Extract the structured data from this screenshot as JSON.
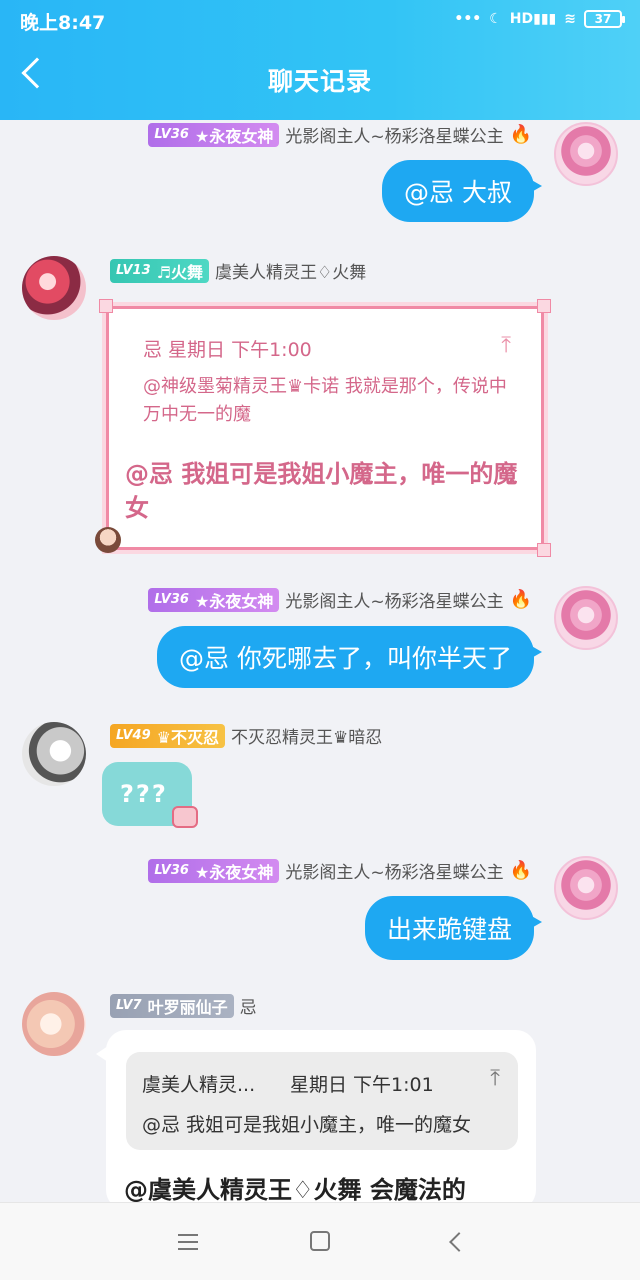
{
  "status_bar": {
    "time": "晚上8:47",
    "signal_text": "HD",
    "battery": "37"
  },
  "header": {
    "title": "聊天记录"
  },
  "messages": [
    {
      "badge_level": "LV36",
      "badge_title": "★永夜女神",
      "name": "光影阁主人~杨彩洛星蝶公主",
      "text": "@忌 大叔"
    },
    {
      "badge_level": "LV13",
      "badge_title": "♬火舞",
      "name": "虞美人精灵王♢火舞",
      "quote_header": "忌  星期日 下午1:00",
      "quote_text": "@神级墨菊精灵王♛卡诺 我就是那个，传说中万中无一的魔",
      "text": "@忌 我姐可是我姐小魔主，唯一的魔女"
    },
    {
      "badge_level": "LV36",
      "badge_title": "★永夜女神",
      "name": "光影阁主人~杨彩洛星蝶公主",
      "text": "@忌 你死哪去了，叫你半天了"
    },
    {
      "badge_level": "LV49",
      "badge_title": "♛不灭忍",
      "name": "不灭忍精灵王♛暗忍",
      "text": "???"
    },
    {
      "badge_level": "LV36",
      "badge_title": "★永夜女神",
      "name": "光影阁主人~杨彩洛星蝶公主",
      "text": "出来跪键盘"
    },
    {
      "badge_level": "LV7",
      "badge_title": "叶罗丽仙子",
      "name": "忌",
      "quote_name": "虞美人精灵...",
      "quote_time": "星期日 下午1:01",
      "quote_text": "@忌 我姐可是我姐小魔主，唯一的魔女",
      "text": "@虞美人精灵王♢火舞 会魔法的"
    }
  ],
  "icons": {
    "fire": "🔥",
    "pin": "⤒"
  },
  "colors": {
    "header": "#29b6f6",
    "bubble_blue": "#1ea8f2",
    "quote_pink": "#d4678a",
    "teal_bubble": "#86d9d8"
  }
}
